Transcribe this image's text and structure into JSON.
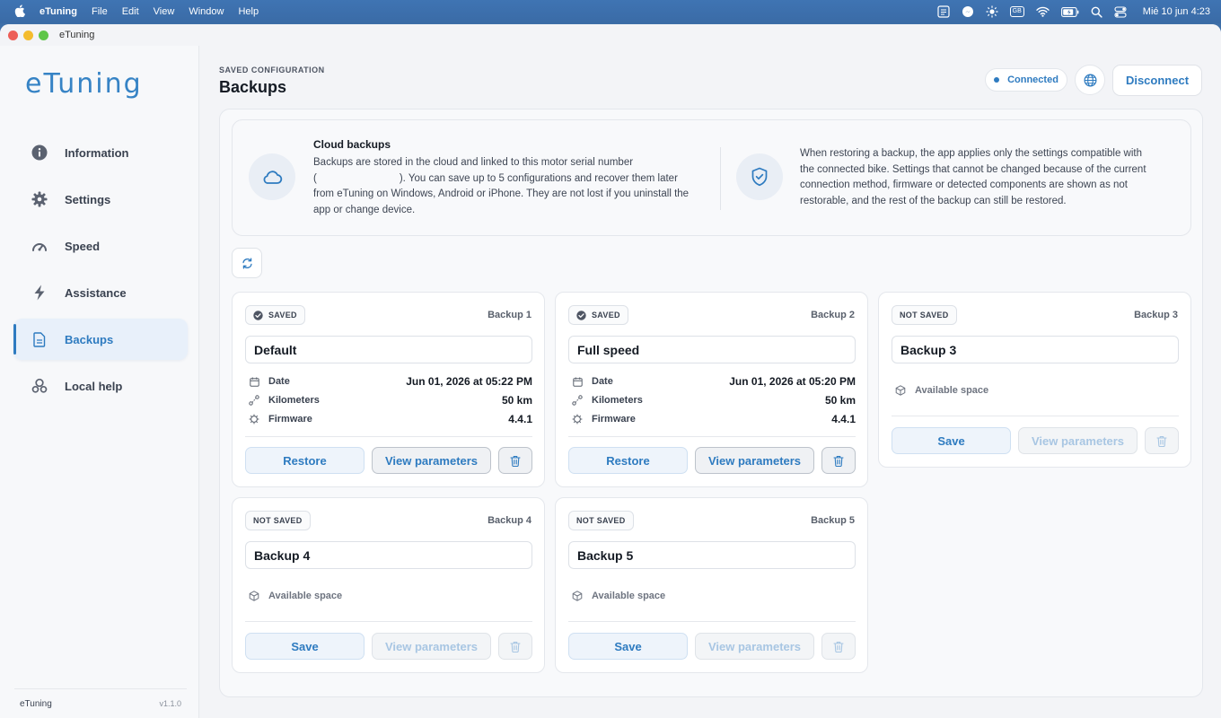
{
  "menubar": {
    "app_name": "eTuning",
    "menus": [
      "File",
      "Edit",
      "View",
      "Window",
      "Help"
    ],
    "keyboard": "GB",
    "clock": "Mié 10 jun 4:23"
  },
  "window": {
    "title": "eTuning"
  },
  "sidebar": {
    "logo": "eTuning",
    "items": [
      {
        "label": "Information",
        "icon": "info-icon"
      },
      {
        "label": "Settings",
        "icon": "gear-icon"
      },
      {
        "label": "Speed",
        "icon": "speedometer-icon"
      },
      {
        "label": "Assistance",
        "icon": "lightning-icon"
      },
      {
        "label": "Backups",
        "icon": "document-icon",
        "active": true
      },
      {
        "label": "Local help",
        "icon": "location-help-icon"
      }
    ],
    "footer_name": "eTuning",
    "footer_version": "v1.1.0"
  },
  "header": {
    "kicker": "SAVED CONFIGURATION",
    "title": "Backups",
    "status": "Connected",
    "disconnect_label": "Disconnect"
  },
  "info": {
    "cloud_title": "Cloud backups",
    "cloud_line1": "Backups are stored in the cloud and linked to this motor serial number",
    "cloud_line2_pre": "(",
    "cloud_line2_post": "). You can save up to 5 configurations and recover them later",
    "cloud_line3": "from eTuning on Windows, Android or iPhone. They are not lost if you uninstall the",
    "cloud_line4": "app or change device.",
    "restore_line1": "When restoring a backup, the app applies only the settings compatible with",
    "restore_line2": "the connected bike. Settings that cannot be changed because of the current",
    "restore_line3": "connection method, firmware or detected components are shown as not",
    "restore_line4": "restorable, and the rest of the backup can still be restored."
  },
  "labels": {
    "date": "Date",
    "kilometers": "Kilometers",
    "firmware": "Firmware",
    "available": "Available space",
    "restore": "Restore",
    "save": "Save",
    "view": "View parameters"
  },
  "backups": [
    {
      "status": "SAVED",
      "slot": "Backup 1",
      "name": "Default",
      "date": "Jun 01, 2026 at 05:22 PM",
      "km": "50 km",
      "firmware": "4.4.1"
    },
    {
      "status": "SAVED",
      "slot": "Backup 2",
      "name": "Full speed",
      "date": "Jun 01, 2026 at 05:20 PM",
      "km": "50 km",
      "firmware": "4.4.1"
    },
    {
      "status": "NOT SAVED",
      "slot": "Backup 3",
      "name": "Backup 3"
    },
    {
      "status": "NOT SAVED",
      "slot": "Backup 4",
      "name": "Backup 4"
    },
    {
      "status": "NOT SAVED",
      "slot": "Backup 5",
      "name": "Backup 5"
    }
  ],
  "colors": {
    "accent": "#2e7bc0",
    "menubar": "#3a6ba6"
  }
}
